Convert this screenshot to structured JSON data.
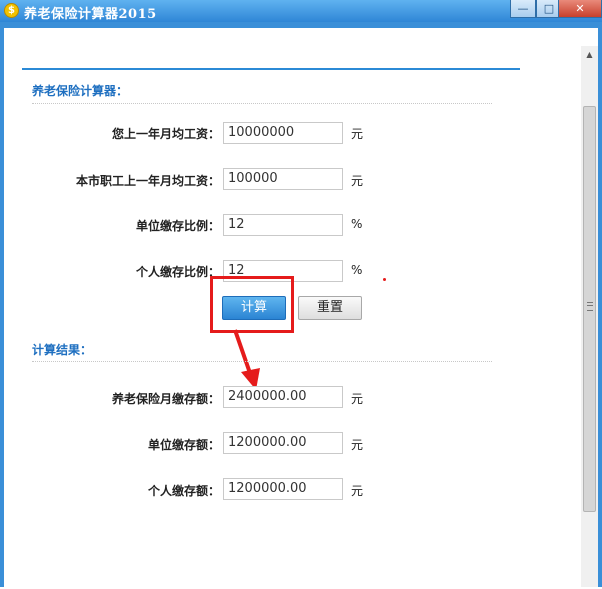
{
  "window": {
    "title": "养老保险计算器2015",
    "app_icon": "$",
    "controls": {
      "minimize": "—",
      "maximize": "□",
      "close": "✕"
    }
  },
  "calculator": {
    "section_title": "养老保险计算器：",
    "fields": [
      {
        "label": "您上一年月均工资：",
        "value": "10000000",
        "unit": "元"
      },
      {
        "label": "本市职工上一年月均工资：",
        "value": "100000",
        "unit": "元"
      },
      {
        "label": "单位缴存比例：",
        "value": "12",
        "unit": "%"
      },
      {
        "label": "个人缴存比例：",
        "value": "12",
        "unit": "%"
      }
    ],
    "calculate_label": "计算",
    "reset_label": "重置"
  },
  "results": {
    "section_title": "计算结果：",
    "fields": [
      {
        "label": "养老保险月缴存额：",
        "value": "2400000.00",
        "unit": "元"
      },
      {
        "label": "单位缴存额：",
        "value": "1200000.00",
        "unit": "元"
      },
      {
        "label": "个人缴存额：",
        "value": "1200000.00",
        "unit": "元"
      }
    ]
  },
  "colors": {
    "accent": "#2b8ad6",
    "highlight": "#e51b1b",
    "section_title": "#1e6fc0"
  }
}
